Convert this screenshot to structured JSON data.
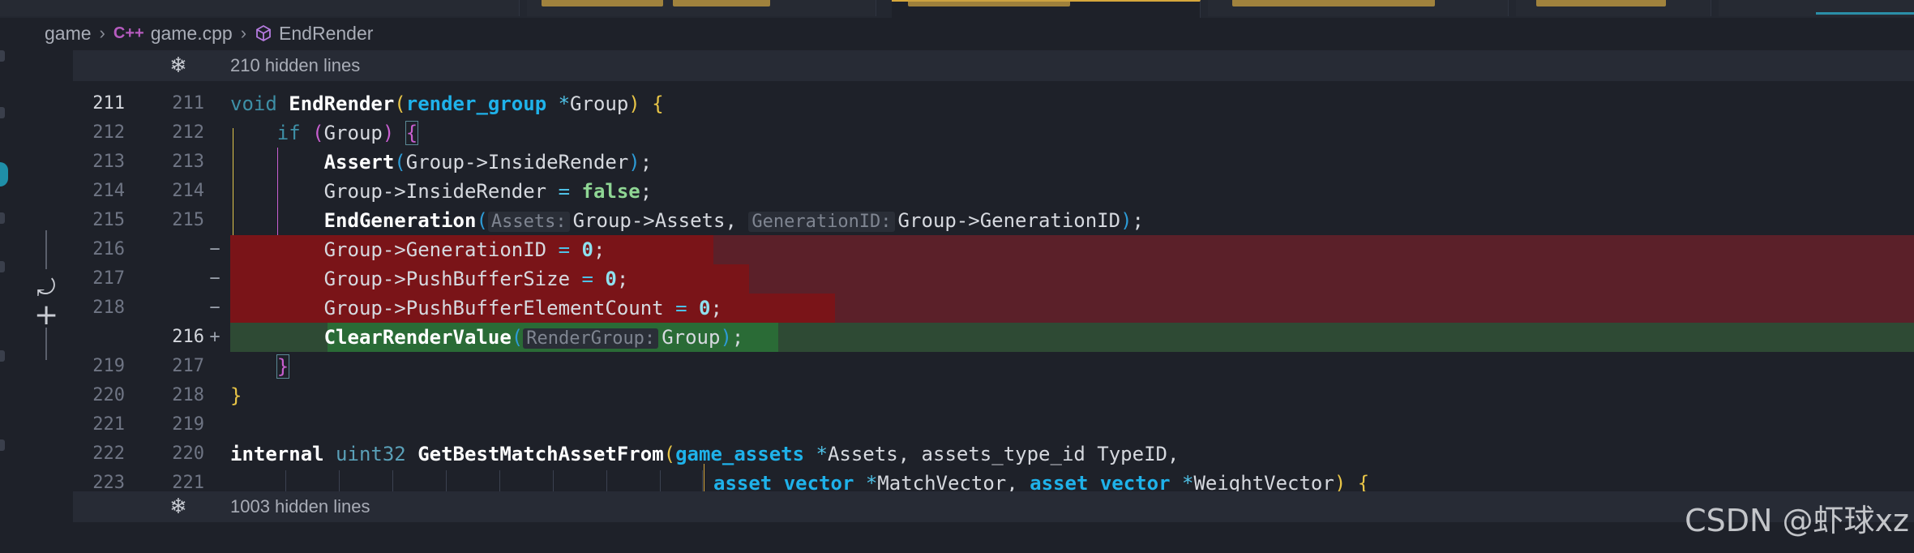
{
  "breadcrumb": {
    "folder": "game",
    "file": "game.cpp",
    "file_icon": "C++",
    "symbol": "EndRender"
  },
  "folds": [
    {
      "text": "210 hidden lines"
    },
    {
      "text": "1003 hidden lines"
    }
  ],
  "gutter": {
    "old": [
      "211",
      "212",
      "213",
      "214",
      "215",
      "216",
      "217",
      "218",
      "",
      "219",
      "220",
      "221",
      "222",
      "223"
    ],
    "new": [
      "211",
      "212",
      "213",
      "214",
      "215",
      "",
      "",
      "",
      "216",
      "217",
      "218",
      "219",
      "220",
      "221"
    ],
    "markers": [
      "",
      "",
      "",
      "",
      "",
      "−",
      "−",
      "−",
      "+",
      "",
      "",
      "",
      "",
      ""
    ]
  },
  "code": {
    "l211": {
      "kw": "void",
      "fn": "EndRender",
      "ty": "render_group",
      "star": "*",
      "arg": "Group",
      "tail": " {"
    },
    "l212": {
      "kw": "if",
      "arg": "Group",
      "tail": "{"
    },
    "l213": {
      "fn": "Assert",
      "body": "Group->InsideRender",
      "tail": ";"
    },
    "l214": {
      "lhs": "Group->InsideRender",
      "op": "=",
      "val": "false",
      "tail": ";"
    },
    "l215": {
      "fn": "EndGeneration",
      "hint1": "Assets:",
      "arg1": "Group->Assets,",
      "hint2": "GenerationID:",
      "arg2": "Group->GenerationID",
      "tail": ";"
    },
    "l216": {
      "lhs": "Group->GenerationID",
      "op": "=",
      "val": "0",
      "tail": ";"
    },
    "l217": {
      "lhs": "Group->PushBufferSize",
      "op": "=",
      "val": "0",
      "tail": ";"
    },
    "l218": {
      "lhs": "Group->PushBufferElementCount",
      "op": "=",
      "val": "0",
      "tail": ";"
    },
    "l216n": {
      "fn": "ClearRenderValue",
      "hint": "RenderGroup:",
      "arg": "Group",
      "tail": ";"
    },
    "l219": {
      "brace": "}"
    },
    "l220": {
      "brace": "}"
    },
    "l222": {
      "kw": "internal",
      "ty0": "uint32",
      "fn": "GetBestMatchAssetFrom",
      "ty": "game_assets",
      "star": "*",
      "arg": "Assets, assets_type_id TypeID,"
    },
    "l223": {
      "ty1": "asset_vector",
      "star1": "*",
      "arg1": "MatchVector,",
      "ty2": "asset_vector",
      "star2": "*",
      "arg2": "WeightVector",
      "tail": " {"
    }
  },
  "watermark": "CSDN @虾球xz",
  "colors": {
    "deleted_line": "#5b2029",
    "deleted_highlight": "#7a1418",
    "added_line": "#2e4a34",
    "added_highlight": "#2a6b36",
    "editor_bg": "#1e2129"
  },
  "icons": {
    "fold": "fold-icon",
    "revert": "revert-icon",
    "add": "plus-icon",
    "symbol": "cube-icon"
  }
}
